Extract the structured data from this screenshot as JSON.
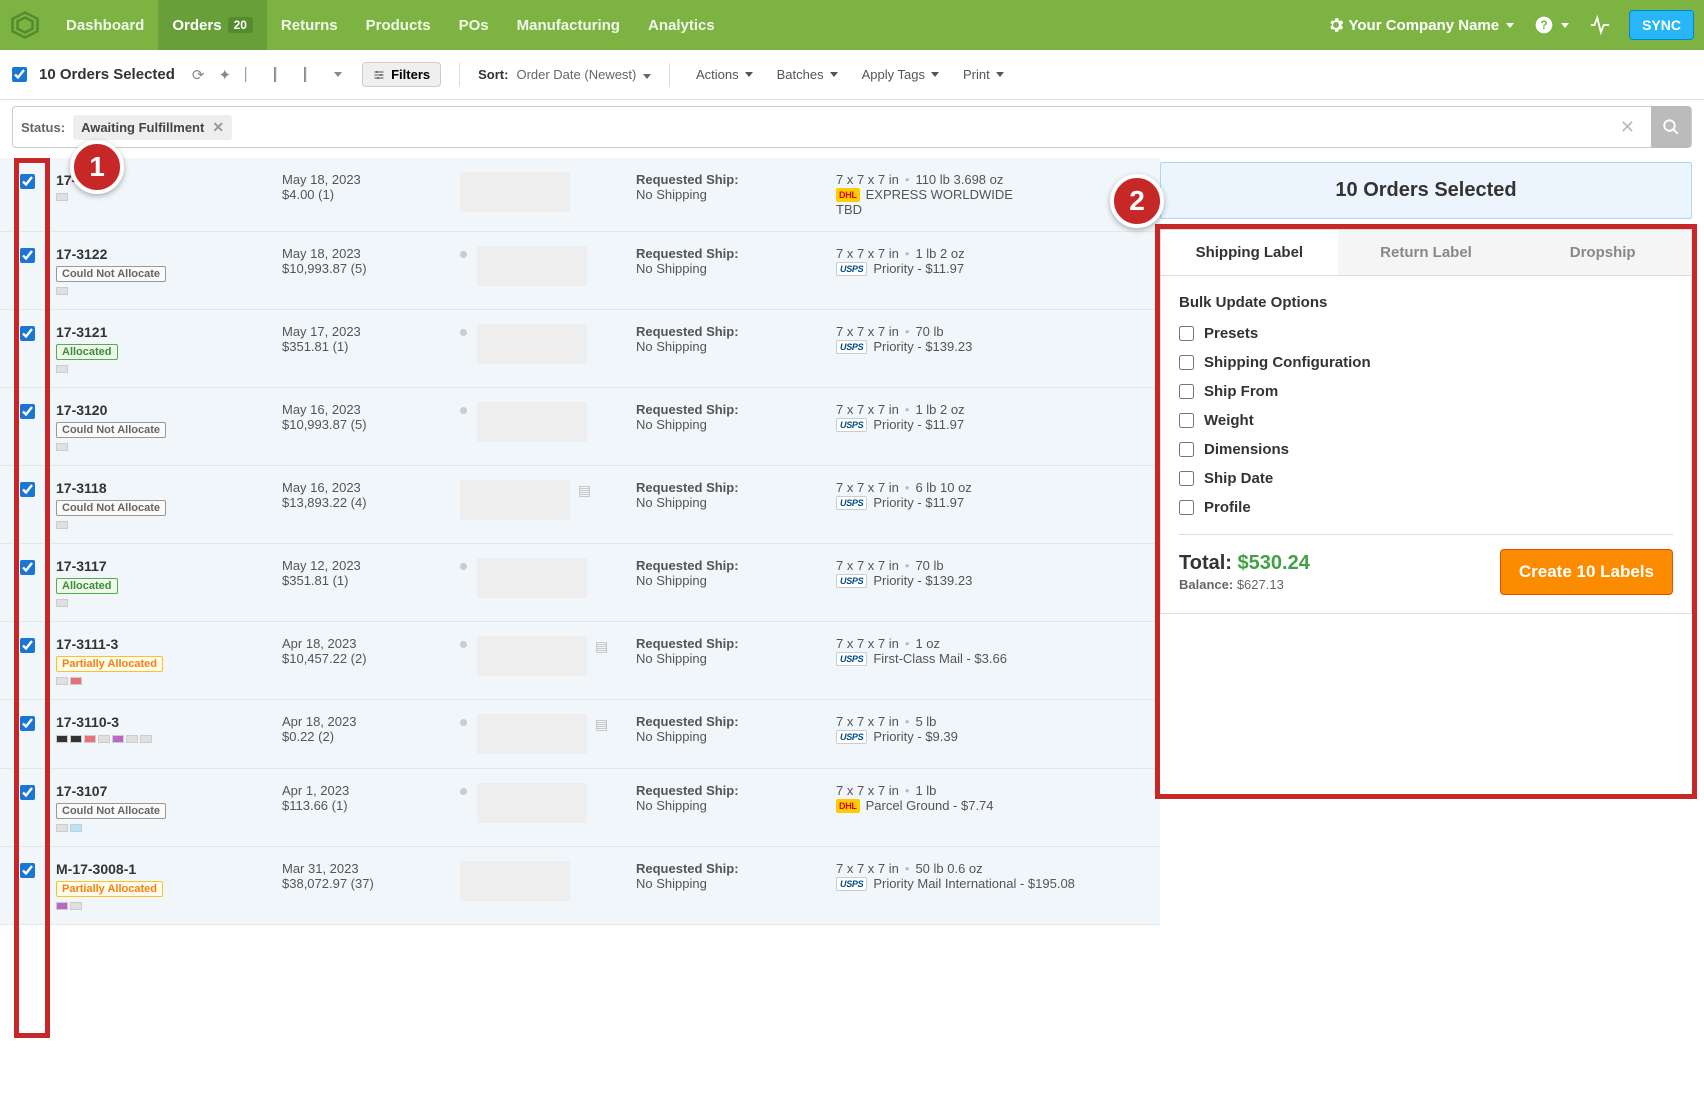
{
  "nav": {
    "items": [
      "Dashboard",
      "Orders",
      "Returns",
      "Products",
      "POs",
      "Manufacturing",
      "Analytics"
    ],
    "orders_badge": "20",
    "company": "Your Company Name",
    "sync": "SYNC"
  },
  "toolbar": {
    "selected": "10 Orders Selected",
    "filters": "Filters",
    "sort_label": "Sort:",
    "sort_value": "Order Date (Newest)",
    "actions": "Actions",
    "batches": "Batches",
    "apply_tags": "Apply Tags",
    "print": "Print"
  },
  "filter": {
    "status_label": "Status:",
    "chip": "Awaiting Fulfillment"
  },
  "orders": [
    {
      "id": "17-",
      "date": "May 18, 2023",
      "amount": "$4.00 (1)",
      "alloc": null,
      "swatches": [
        "#e0e0e0"
      ],
      "reqship": "Requested Ship:",
      "shipping": "No Shipping",
      "dims": "7 x 7 x 7 in",
      "weight": "110 lb  3.698 oz",
      "carrier": "dhl",
      "service": "EXPRESS WORLDWIDE",
      "price": "TBD",
      "thumbDot": false,
      "thumbIcon": false
    },
    {
      "id": "17-3122",
      "date": "May 18, 2023",
      "amount": "$10,993.87 (5)",
      "alloc": "could-not",
      "alloc_label": "Could Not Allocate",
      "swatches": [
        "#e0e0e0"
      ],
      "reqship": "Requested Ship:",
      "shipping": "No Shipping",
      "dims": "7 x 7 x 7 in",
      "weight": "1 lb  2 oz",
      "carrier": "usps",
      "service": "Priority - $11.97",
      "price": "",
      "thumbDot": true,
      "thumbIcon": false
    },
    {
      "id": "17-3121",
      "date": "May 17, 2023",
      "amount": "$351.81 (1)",
      "alloc": "allocated",
      "alloc_label": "Allocated",
      "swatches": [
        "#e0e0e0"
      ],
      "reqship": "Requested Ship:",
      "shipping": "No Shipping",
      "dims": "7 x 7 x 7 in",
      "weight": "70 lb",
      "carrier": "usps",
      "service": "Priority - $139.23",
      "price": "",
      "thumbDot": true,
      "thumbIcon": false
    },
    {
      "id": "17-3120",
      "date": "May 16, 2023",
      "amount": "$10,993.87 (5)",
      "alloc": "could-not",
      "alloc_label": "Could Not Allocate",
      "swatches": [
        "#e0e0e0"
      ],
      "reqship": "Requested Ship:",
      "shipping": "No Shipping",
      "dims": "7 x 7 x 7 in",
      "weight": "1 lb  2 oz",
      "carrier": "usps",
      "service": "Priority - $11.97",
      "price": "",
      "thumbDot": true,
      "thumbIcon": false
    },
    {
      "id": "17-3118",
      "date": "May 16, 2023",
      "amount": "$13,893.22 (4)",
      "alloc": "could-not",
      "alloc_label": "Could Not Allocate",
      "swatches": [
        "#e0e0e0"
      ],
      "reqship": "Requested Ship:",
      "shipping": "No Shipping",
      "dims": "7 x 7 x 7 in",
      "weight": "6 lb  10 oz",
      "carrier": "usps",
      "service": "Priority - $11.97",
      "price": "",
      "thumbDot": false,
      "thumbIcon": true
    },
    {
      "id": "17-3117",
      "date": "May 12, 2023",
      "amount": "$351.81 (1)",
      "alloc": "allocated",
      "alloc_label": "Allocated",
      "swatches": [
        "#e0e0e0"
      ],
      "reqship": "Requested Ship:",
      "shipping": "No Shipping",
      "dims": "7 x 7 x 7 in",
      "weight": "70 lb",
      "carrier": "usps",
      "service": "Priority - $139.23",
      "price": "",
      "thumbDot": true,
      "thumbIcon": false
    },
    {
      "id": "17-3111-3",
      "date": "Apr 18, 2023",
      "amount": "$10,457.22 (2)",
      "alloc": "partial",
      "alloc_label": "Partially Allocated",
      "swatches": [
        "#e0e0e0",
        "#E57373"
      ],
      "reqship": "Requested Ship:",
      "shipping": "No Shipping",
      "dims": "7 x 7 x 7 in",
      "weight": "1 oz",
      "carrier": "usps",
      "service": "First-Class Mail - $3.66",
      "price": "",
      "thumbDot": true,
      "thumbIcon": true
    },
    {
      "id": "17-3110-3",
      "date": "Apr 18, 2023",
      "amount": "$0.22 (2)",
      "alloc": null,
      "swatches": [
        "#333",
        "#333",
        "#E57373",
        "#e0e0e0",
        "#BA68C8",
        "#e0e0e0",
        "#e0e0e0"
      ],
      "reqship": "Requested Ship:",
      "shipping": "No Shipping",
      "dims": "7 x 7 x 7 in",
      "weight": "5 lb",
      "carrier": "usps",
      "service": "Priority - $9.39",
      "price": "",
      "thumbDot": true,
      "thumbIcon": true
    },
    {
      "id": "17-3107",
      "date": "Apr 1, 2023",
      "amount": "$113.66 (1)",
      "alloc": "could-not",
      "alloc_label": "Could Not Allocate",
      "swatches": [
        "#e0e0e0",
        "#B3E5FC"
      ],
      "reqship": "Requested Ship:",
      "shipping": "No Shipping",
      "dims": "7 x 7 x 7 in",
      "weight": "1 lb",
      "carrier": "dhl",
      "service": "Parcel Ground - $7.74",
      "price": "",
      "thumbDot": true,
      "thumbIcon": false
    },
    {
      "id": "M-17-3008-1",
      "date": "Mar 31, 2023",
      "amount": "$38,072.97 (37)",
      "alloc": "partial",
      "alloc_label": "Partially Allocated",
      "swatches": [
        "#BA68C8",
        "#e0e0e0"
      ],
      "reqship": "Requested Ship:",
      "shipping": "No Shipping",
      "dims": "7 x 7 x 7 in",
      "weight": "50 lb  0.6 oz",
      "carrier": "usps",
      "service": "Priority Mail International - $195.08",
      "price": "",
      "thumbDot": false,
      "thumbIcon": false
    }
  ],
  "carrier_labels": {
    "dhl": "DHL",
    "usps": "USPS"
  },
  "side": {
    "header": "10 Orders Selected",
    "tabs": [
      "Shipping Label",
      "Return Label",
      "Dropship"
    ],
    "bulk_title": "Bulk Update Options",
    "options": [
      "Presets",
      "Shipping Configuration",
      "Ship From",
      "Weight",
      "Dimensions",
      "Ship Date",
      "Profile"
    ],
    "total_label": "Total:",
    "total_amount": "$530.24",
    "balance_label": "Balance:",
    "balance_amount": "$627.13",
    "create_btn": "Create 10 Labels"
  },
  "callouts": {
    "one": "1",
    "two": "2"
  }
}
